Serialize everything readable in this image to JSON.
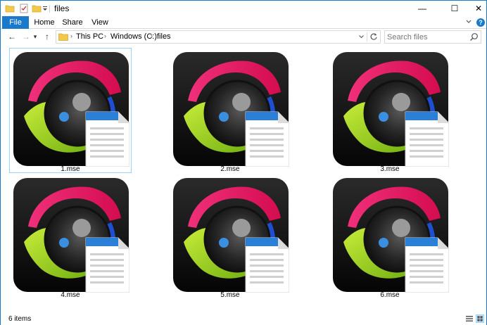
{
  "window": {
    "title": "files",
    "controls": {
      "minimize": "—",
      "maximize": "☐",
      "close": "✕"
    }
  },
  "ribbon": {
    "tabs": [
      {
        "label": "File",
        "active": true
      },
      {
        "label": "Home"
      },
      {
        "label": "Share"
      },
      {
        "label": "View"
      }
    ],
    "expand_icon": "chevron-down-icon",
    "help_label": "?"
  },
  "navigation": {
    "back": "←",
    "forward": "→",
    "recent": "▾",
    "up": "↑",
    "breadcrumb": [
      "This PC",
      "Windows (C:)",
      "files"
    ],
    "separator": "›",
    "search_placeholder": "Search files"
  },
  "files": [
    {
      "name": "1.mse",
      "selected": true
    },
    {
      "name": "2.mse"
    },
    {
      "name": "3.mse"
    },
    {
      "name": "4.mse"
    },
    {
      "name": "5.mse"
    },
    {
      "name": "6.mse"
    }
  ],
  "status": {
    "item_count": "6 items"
  },
  "colors": {
    "accent": "#1979ca",
    "icon_pink": "#e8145f",
    "icon_green": "#9bd21a",
    "icon_blue": "#1e4fd0",
    "doc_header": "#2b7fd6"
  }
}
